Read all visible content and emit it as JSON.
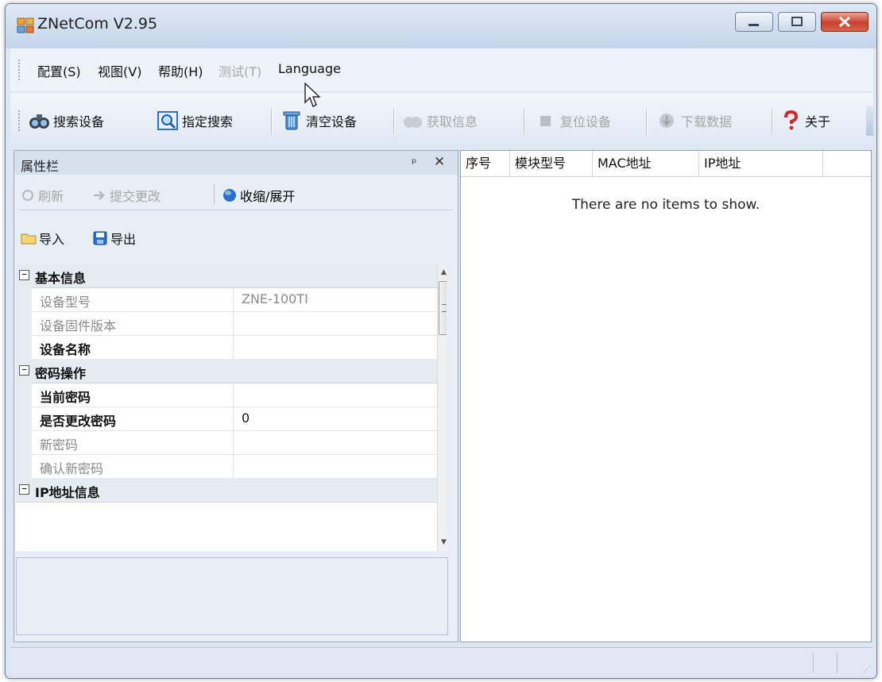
{
  "window": {
    "title": "ZNetCom V2.95"
  },
  "menu": [
    {
      "label": "配置(S)",
      "enabled": true
    },
    {
      "label": "视图(V)",
      "enabled": true
    },
    {
      "label": "帮助(H)",
      "enabled": true
    },
    {
      "label": "测试(T)",
      "enabled": false
    },
    {
      "label": "Language",
      "enabled": true
    }
  ],
  "toolbar": {
    "search": "搜索设备",
    "specify_search": "指定搜索",
    "clear": "清空设备",
    "get_info": "获取信息",
    "reset": "复位设备",
    "download": "下载数据",
    "about": "关于"
  },
  "property_pane": {
    "title": "属性栏",
    "refresh": "刷新",
    "submit": "提交更改",
    "collapse": "收缩/展开",
    "import": "导入",
    "export": "导出",
    "categories": {
      "basic": "基本信息",
      "password": "密码操作",
      "ip": "IP地址信息"
    },
    "rows": [
      {
        "name": "设备型号",
        "value": "ZNE-100TI"
      },
      {
        "name": "设备固件版本",
        "value": ""
      },
      {
        "name": "设备名称",
        "value": ""
      },
      {
        "name": "当前密码",
        "value": ""
      },
      {
        "name": "是否更改密码",
        "value": "0"
      },
      {
        "name": "新密码",
        "value": ""
      },
      {
        "name": "确认新密码",
        "value": ""
      }
    ]
  },
  "device_list": {
    "columns": [
      "序号",
      "模块型号",
      "MAC地址",
      "IP地址"
    ],
    "empty_message": "There are no items to show."
  },
  "colors": {
    "title_gradient_top": "#dfe9f5",
    "close_button": "#c8402c",
    "accent_blue": "#2a6fc9"
  }
}
